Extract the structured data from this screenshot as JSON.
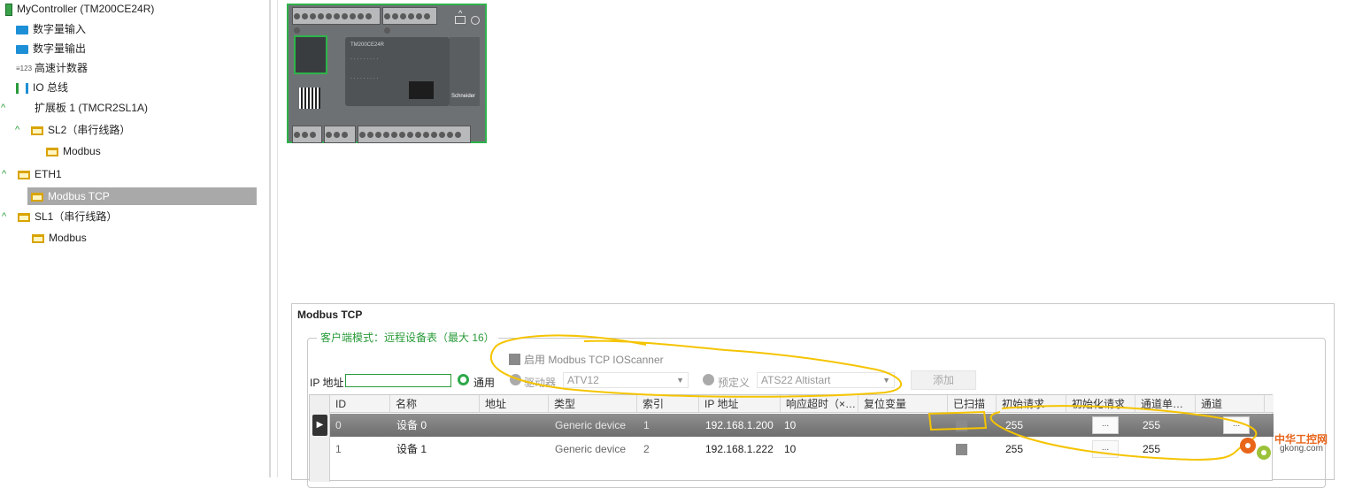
{
  "tree": {
    "controller": "MyController (TM200CE24R)",
    "items": [
      {
        "label": "数字量输入",
        "icon": "digital-input-icon"
      },
      {
        "label": "数字量输出",
        "icon": "digital-output-icon"
      },
      {
        "label": "高速计数器",
        "icon": "counter-icon"
      },
      {
        "label": "IO 总线",
        "icon": "io-bus-icon"
      },
      {
        "label": "扩展板 1 (TMCR2SL1A)",
        "icon": "expansion-icon"
      },
      {
        "label": "SL2（串行线路）",
        "icon": "serial-port-icon"
      },
      {
        "label": "Modbus",
        "icon": "modbus-icon"
      },
      {
        "label": "ETH1",
        "icon": "ethernet-port-icon"
      },
      {
        "label": "Modbus TCP",
        "icon": "modbus-icon",
        "selected": true
      },
      {
        "label": "SL1（串行线路）",
        "icon": "serial-port-icon"
      },
      {
        "label": "Modbus",
        "icon": "modbus-icon"
      }
    ]
  },
  "panel": {
    "title": "Modbus TCP",
    "group_legend": "客户端模式：远程设备表（最大 16）",
    "enable_ioscanner": "启用 Modbus TCP IOScanner",
    "ip_label": "IP 地址",
    "ip_value": "",
    "radio_generic": "通用",
    "radio_drive": "驱动器",
    "drive_value": "ATV12",
    "radio_predefined": "预定义",
    "predefined_value": "ATS22 Altistart",
    "add_button": "添加"
  },
  "table": {
    "columns": [
      "ID",
      "名称",
      "地址",
      "类型",
      "索引",
      "IP 地址",
      "响应超时（×…",
      "复位变量",
      "已扫描",
      "初始请求",
      "初始化请求",
      "通道单…",
      "通道"
    ],
    "rows": [
      {
        "id": "0",
        "name": "设备 0",
        "address": "",
        "type": "Generic device",
        "index": "1",
        "ip": "192.168.1.200",
        "timeout": "10",
        "reset": "",
        "initial_request": "255",
        "init_btn": "...",
        "channel_unit": "255",
        "channel_btn": "...",
        "selected": true
      },
      {
        "id": "1",
        "name": "设备 1",
        "address": "",
        "type": "Generic device",
        "index": "2",
        "ip": "192.168.1.222",
        "timeout": "10",
        "reset": "",
        "initial_request": "255",
        "init_btn": "...",
        "channel_unit": "255",
        "channel_btn": ""
      }
    ]
  },
  "watermark": {
    "line1": "中华工控网",
    "line2": "gkong.com"
  },
  "colors": {
    "accent_green": "#2a9b3a",
    "annotation_yellow": "#f5c400",
    "selection_gray": "#a9a9a9"
  }
}
